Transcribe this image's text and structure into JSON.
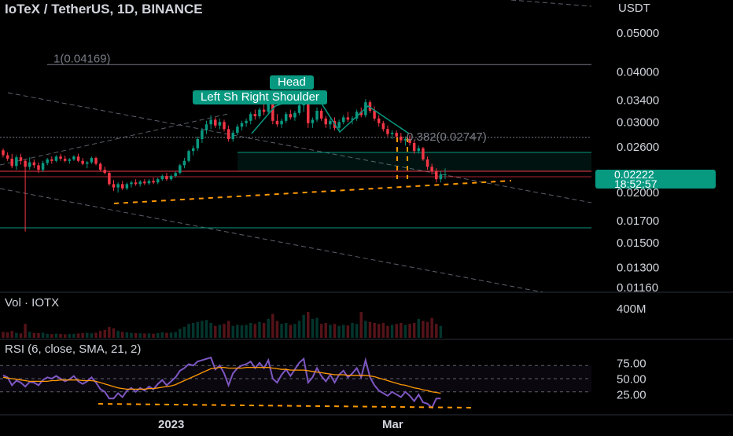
{
  "header": {
    "title": "IoTeX / TetherUS, 1D, BINANCE",
    "currency": "USDT"
  },
  "price_axis": [
    "0.05000",
    "0.04000",
    "0.03400",
    "0.03000",
    "0.02600",
    "0.02200",
    "0.02000",
    "0.01700",
    "0.01500",
    "0.01300",
    "0.01160"
  ],
  "last_price": {
    "value": "0.02222",
    "countdown": "18:52:57"
  },
  "annotations": {
    "fib_top": "1(0.04169)",
    "fib_382": "0.382(0.02747)",
    "head": "Head",
    "shoulders": "Left Sh  Right Shoulder"
  },
  "volume_pane": {
    "label": "Vol · IOTX",
    "axis": [
      "400M"
    ]
  },
  "rsi_pane": {
    "label": "RSI (6, close, SMA, 21, 2)",
    "axis": [
      "75.00",
      "50.00",
      "25.00"
    ]
  },
  "time_axis": [
    "2023",
    "Mar"
  ],
  "colors": {
    "up": "#089981",
    "down": "#f23645",
    "rsi": "#7e57c2",
    "rsi_ma": "#ff9800",
    "dashed": "#ff9800"
  },
  "chart_data": {
    "type": "candlestick",
    "title": "IoTeX / TetherUS, 1D, BINANCE",
    "y_scale": "log",
    "ylim": [
      0.0116,
      0.06
    ],
    "candles": [
      [
        0.0255,
        0.0258,
        0.0245,
        0.0248
      ],
      [
        0.0248,
        0.0252,
        0.024,
        0.0243
      ],
      [
        0.0243,
        0.025,
        0.023,
        0.0233
      ],
      [
        0.0233,
        0.0248,
        0.0228,
        0.0245
      ],
      [
        0.0245,
        0.025,
        0.0235,
        0.024
      ],
      [
        0.024,
        0.0242,
        0.016,
        0.0232
      ],
      [
        0.0232,
        0.0245,
        0.0228,
        0.0238
      ],
      [
        0.0238,
        0.0242,
        0.023,
        0.0234
      ],
      [
        0.0234,
        0.0238,
        0.0224,
        0.0228
      ],
      [
        0.0228,
        0.024,
        0.0225,
        0.0237
      ],
      [
        0.0237,
        0.0244,
        0.0234,
        0.0242
      ],
      [
        0.0242,
        0.0246,
        0.0236,
        0.024
      ],
      [
        0.024,
        0.0248,
        0.0238,
        0.0246
      ],
      [
        0.0246,
        0.025,
        0.024,
        0.0243
      ],
      [
        0.0243,
        0.0247,
        0.0238,
        0.024
      ],
      [
        0.024,
        0.0244,
        0.0236,
        0.0242
      ],
      [
        0.0242,
        0.0248,
        0.024,
        0.0246
      ],
      [
        0.0246,
        0.025,
        0.0238,
        0.024
      ],
      [
        0.024,
        0.0244,
        0.0234,
        0.0236
      ],
      [
        0.0236,
        0.024,
        0.023,
        0.0238
      ],
      [
        0.0238,
        0.0246,
        0.0236,
        0.0244
      ],
      [
        0.0244,
        0.0246,
        0.0234,
        0.0236
      ],
      [
        0.0236,
        0.0238,
        0.0226,
        0.0228
      ],
      [
        0.0228,
        0.0232,
        0.0222,
        0.0224
      ],
      [
        0.0224,
        0.0226,
        0.0208,
        0.021
      ],
      [
        0.021,
        0.0215,
        0.0202,
        0.0206
      ],
      [
        0.0206,
        0.0212,
        0.02,
        0.021
      ],
      [
        0.021,
        0.0214,
        0.0203,
        0.0205
      ],
      [
        0.0205,
        0.0212,
        0.0203,
        0.021
      ],
      [
        0.021,
        0.0214,
        0.0206,
        0.0212
      ],
      [
        0.0212,
        0.0216,
        0.0208,
        0.021
      ],
      [
        0.021,
        0.0215,
        0.0207,
        0.0213
      ],
      [
        0.0213,
        0.0216,
        0.0209,
        0.0211
      ],
      [
        0.0211,
        0.0216,
        0.0209,
        0.0214
      ],
      [
        0.0214,
        0.0218,
        0.021,
        0.0212
      ],
      [
        0.0212,
        0.0218,
        0.021,
        0.0216
      ],
      [
        0.0216,
        0.0222,
        0.0214,
        0.022
      ],
      [
        0.022,
        0.0224,
        0.0214,
        0.0216
      ],
      [
        0.0216,
        0.0222,
        0.0214,
        0.022
      ],
      [
        0.022,
        0.0226,
        0.0218,
        0.0224
      ],
      [
        0.0224,
        0.0236,
        0.0222,
        0.0234
      ],
      [
        0.0234,
        0.0244,
        0.023,
        0.024
      ],
      [
        0.024,
        0.0256,
        0.0238,
        0.0254
      ],
      [
        0.0254,
        0.0262,
        0.0248,
        0.0258
      ],
      [
        0.0258,
        0.0276,
        0.0254,
        0.0272
      ],
      [
        0.0272,
        0.029,
        0.0266,
        0.0286
      ],
      [
        0.0286,
        0.0302,
        0.028,
        0.0296
      ],
      [
        0.0296,
        0.0312,
        0.0288,
        0.0304
      ],
      [
        0.0304,
        0.0308,
        0.029,
        0.0294
      ],
      [
        0.0294,
        0.0306,
        0.0288,
        0.03
      ],
      [
        0.03,
        0.0304,
        0.0284,
        0.0288
      ],
      [
        0.0288,
        0.0294,
        0.0268,
        0.0272
      ],
      [
        0.0272,
        0.0286,
        0.0268,
        0.0282
      ],
      [
        0.0282,
        0.0296,
        0.0278,
        0.0292
      ],
      [
        0.0292,
        0.0302,
        0.0286,
        0.0298
      ],
      [
        0.0298,
        0.0306,
        0.0292,
        0.0302
      ],
      [
        0.0302,
        0.0318,
        0.0296,
        0.0314
      ],
      [
        0.0314,
        0.0322,
        0.0304,
        0.031
      ],
      [
        0.031,
        0.0326,
        0.0306,
        0.0322
      ],
      [
        0.0322,
        0.0334,
        0.0312,
        0.0318
      ],
      [
        0.0318,
        0.034,
        0.0314,
        0.0334
      ],
      [
        0.0334,
        0.034,
        0.0296,
        0.0302
      ],
      [
        0.0302,
        0.0314,
        0.0292,
        0.0296
      ],
      [
        0.0296,
        0.0306,
        0.029,
        0.0302
      ],
      [
        0.0302,
        0.0318,
        0.0298,
        0.0314
      ],
      [
        0.0314,
        0.0322,
        0.0304,
        0.0308
      ],
      [
        0.0308,
        0.032,
        0.0302,
        0.0316
      ],
      [
        0.0316,
        0.0334,
        0.0312,
        0.033
      ],
      [
        0.033,
        0.0348,
        0.0318,
        0.034
      ],
      [
        0.034,
        0.0346,
        0.029,
        0.0298
      ],
      [
        0.0298,
        0.0308,
        0.029,
        0.0304
      ],
      [
        0.0304,
        0.0326,
        0.03,
        0.032
      ],
      [
        0.032,
        0.0324,
        0.0302,
        0.0306
      ],
      [
        0.0306,
        0.031,
        0.029,
        0.0296
      ],
      [
        0.0296,
        0.0306,
        0.0288,
        0.0302
      ],
      [
        0.0302,
        0.0308,
        0.0286,
        0.029
      ],
      [
        0.029,
        0.0304,
        0.0284,
        0.03
      ],
      [
        0.03,
        0.0312,
        0.0296,
        0.0308
      ],
      [
        0.0308,
        0.0318,
        0.03,
        0.0304
      ],
      [
        0.0304,
        0.031,
        0.0296,
        0.0306
      ],
      [
        0.0306,
        0.0322,
        0.0302,
        0.0318
      ],
      [
        0.0318,
        0.0326,
        0.0308,
        0.0312
      ],
      [
        0.0312,
        0.0342,
        0.0308,
        0.0336
      ],
      [
        0.0336,
        0.034,
        0.0316,
        0.032
      ],
      [
        0.032,
        0.0328,
        0.0302,
        0.0306
      ],
      [
        0.0306,
        0.0312,
        0.0292,
        0.0298
      ],
      [
        0.0298,
        0.0302,
        0.0284,
        0.0288
      ],
      [
        0.0288,
        0.0294,
        0.0276,
        0.028
      ],
      [
        0.028,
        0.0286,
        0.0272,
        0.0282
      ],
      [
        0.0282,
        0.0286,
        0.0272,
        0.0276
      ],
      [
        0.0276,
        0.0282,
        0.0266,
        0.027
      ],
      [
        0.027,
        0.0276,
        0.0262,
        0.0272
      ],
      [
        0.0272,
        0.0278,
        0.0262,
        0.0266
      ],
      [
        0.0266,
        0.027,
        0.025,
        0.0254
      ],
      [
        0.0254,
        0.0262,
        0.025,
        0.0258
      ],
      [
        0.0258,
        0.026,
        0.024,
        0.0242
      ],
      [
        0.0242,
        0.0246,
        0.0228,
        0.0232
      ],
      [
        0.0232,
        0.0236,
        0.0222,
        0.0226
      ],
      [
        0.0226,
        0.023,
        0.0212,
        0.0216
      ],
      [
        0.0216,
        0.0226,
        0.0212,
        0.0222
      ],
      [
        0.0222,
        0.023,
        0.0216,
        0.0222
      ]
    ],
    "volume": [
      60,
      55,
      70,
      50,
      45,
      140,
      60,
      50,
      48,
      52,
      40,
      38,
      42,
      40,
      36,
      38,
      40,
      44,
      48,
      50,
      46,
      52,
      70,
      80,
      110,
      95,
      70,
      60,
      55,
      50,
      48,
      46,
      44,
      45,
      42,
      48,
      55,
      50,
      52,
      58,
      90,
      110,
      140,
      150,
      160,
      170,
      180,
      150,
      120,
      130,
      140,
      170,
      120,
      130,
      125,
      130,
      150,
      140,
      160,
      150,
      190,
      240,
      170,
      140,
      150,
      130,
      140,
      170,
      230,
      260,
      190,
      200,
      140,
      150,
      130,
      140,
      120,
      130,
      125,
      150,
      140,
      260,
      170,
      160,
      150,
      140,
      150,
      120,
      130,
      140,
      150,
      130,
      140,
      150,
      190,
      170,
      160,
      200,
      140,
      120
    ],
    "rsi": [
      55,
      52,
      40,
      47,
      44,
      38,
      45,
      44,
      40,
      48,
      52,
      50,
      54,
      50,
      46,
      49,
      54,
      46,
      42,
      46,
      52,
      44,
      34,
      30,
      20,
      20,
      28,
      22,
      32,
      36,
      30,
      36,
      32,
      38,
      34,
      42,
      48,
      40,
      46,
      52,
      62,
      66,
      72,
      70,
      76,
      78,
      80,
      82,
      64,
      70,
      58,
      40,
      58,
      66,
      70,
      72,
      76,
      66,
      74,
      66,
      78,
      50,
      44,
      56,
      64,
      54,
      64,
      74,
      80,
      44,
      52,
      66,
      54,
      46,
      56,
      44,
      56,
      62,
      52,
      58,
      66,
      52,
      78,
      52,
      40,
      32,
      28,
      24,
      30,
      26,
      22,
      30,
      24,
      16,
      26,
      14,
      12,
      6,
      20,
      20
    ],
    "rsi_ma": [
      52,
      51,
      50,
      49,
      48,
      47,
      46,
      46,
      46,
      46,
      46,
      47,
      47,
      48,
      48,
      48,
      48,
      48,
      47,
      47,
      47,
      46,
      44,
      42,
      40,
      38,
      36,
      35,
      34,
      34,
      34,
      34,
      34,
      35,
      35,
      36,
      37,
      38,
      39,
      41,
      44,
      47,
      50,
      53,
      56,
      59,
      62,
      65,
      66,
      67,
      67,
      66,
      66,
      66,
      66,
      67,
      67,
      67,
      67,
      67,
      67,
      66,
      65,
      64,
      64,
      63,
      63,
      63,
      63,
      62,
      61,
      60,
      59,
      58,
      57,
      56,
      56,
      56,
      55,
      55,
      55,
      55,
      55,
      54,
      53,
      51,
      49,
      47,
      45,
      43,
      41,
      40,
      38,
      36,
      35,
      33,
      32,
      30,
      29,
      28
    ],
    "levels": {
      "fib_1": 0.04169,
      "fib_0382": 0.02747
    },
    "x_labels": [
      "2023",
      "Mar"
    ]
  }
}
